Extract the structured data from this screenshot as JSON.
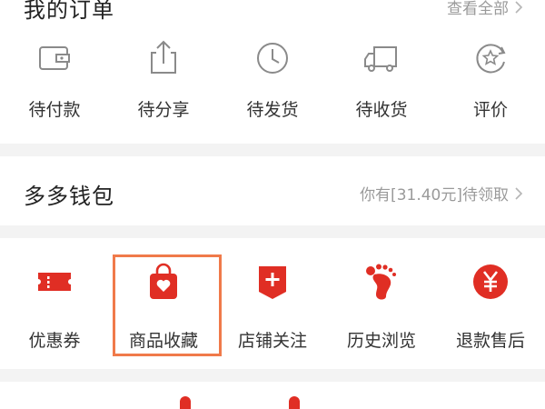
{
  "orders": {
    "title": "我的订单",
    "view_all": "查看全部",
    "items": [
      {
        "label": "待付款",
        "icon": "wallet-icon"
      },
      {
        "label": "待分享",
        "icon": "share-icon"
      },
      {
        "label": "待发货",
        "icon": "clock-icon"
      },
      {
        "label": "待收货",
        "icon": "truck-icon"
      },
      {
        "label": "评价",
        "icon": "review-icon"
      }
    ]
  },
  "wallet": {
    "title": "多多钱包",
    "note": "你有[31.40元]待领取"
  },
  "tools": {
    "items": [
      {
        "label": "优惠券",
        "icon": "coupon-icon"
      },
      {
        "label": "商品收藏",
        "icon": "favorite-bag-icon"
      },
      {
        "label": "店铺关注",
        "icon": "store-follow-icon"
      },
      {
        "label": "历史浏览",
        "icon": "footprint-icon"
      },
      {
        "label": "退款售后",
        "icon": "refund-icon"
      }
    ]
  },
  "colors": {
    "accent": "#e02e24",
    "highlight": "#f07a4a",
    "icon_gray": "#8a8a8a"
  }
}
